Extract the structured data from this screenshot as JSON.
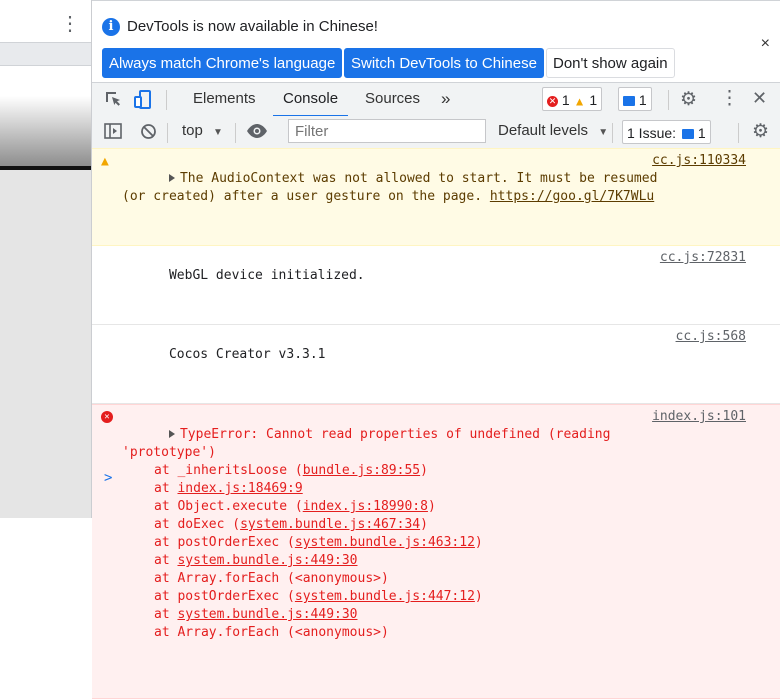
{
  "infobar": {
    "message": "DevTools is now available in Chinese!",
    "btn_match": "Always match Chrome's language",
    "btn_switch": "Switch DevTools to Chinese",
    "btn_dont_show": "Don't show again",
    "close": "×",
    "info_glyph": "i"
  },
  "tabs": {
    "elements": "Elements",
    "console": "Console",
    "sources": "Sources",
    "more": "»"
  },
  "counts": {
    "errors": "1",
    "warnings": "1",
    "messages": "1"
  },
  "filterbar": {
    "context": "top",
    "filter_placeholder": "Filter",
    "levels": "Default levels",
    "issues": "1 Issue:",
    "issues_count": "1"
  },
  "log": {
    "warning": {
      "line1": "The AudioContext was not allowed to start. It must be resumed",
      "line2_prefix": "(or created) after a user gesture on the page. ",
      "line2_link": "https://goo.gl/7K7WLu",
      "source": "cc.js:110334"
    },
    "info1": {
      "text": "WebGL device initialized.",
      "source": "cc.js:72831"
    },
    "info2": {
      "text": "Cocos Creator v3.3.1",
      "source": "cc.js:568"
    },
    "error": {
      "line1": "TypeError: Cannot read properties of undefined (reading",
      "line2": "'prototype')",
      "source": "index.js:101",
      "frames": [
        {
          "prefix": "at _inheritsLoose (",
          "loc": "bundle.js:89:55",
          "suffix": ")"
        },
        {
          "prefix": "at ",
          "loc": "index.js:18469:9",
          "suffix": ""
        },
        {
          "prefix": "at Object.execute (",
          "loc": "index.js:18990:8",
          "suffix": ")"
        },
        {
          "prefix": "at doExec (",
          "loc": "system.bundle.js:467:34",
          "suffix": ")"
        },
        {
          "prefix": "at postOrderExec (",
          "loc": "system.bundle.js:463:12",
          "suffix": ")"
        },
        {
          "prefix": "at ",
          "loc": "system.bundle.js:449:30",
          "suffix": ""
        },
        {
          "prefix": "at Array.forEach (<anonymous>)",
          "loc": "",
          "suffix": ""
        },
        {
          "prefix": "at postOrderExec (",
          "loc": "system.bundle.js:447:12",
          "suffix": ")"
        },
        {
          "prefix": "at ",
          "loc": "system.bundle.js:449:30",
          "suffix": ""
        },
        {
          "prefix": "at Array.forEach (<anonymous>)",
          "loc": "",
          "suffix": ""
        }
      ]
    },
    "prompt": ">"
  },
  "colors": {
    "accent": "#1a73e8",
    "error": "#e41e1e",
    "warning_bg": "#fffbe5",
    "error_bg": "#fff0f0"
  }
}
